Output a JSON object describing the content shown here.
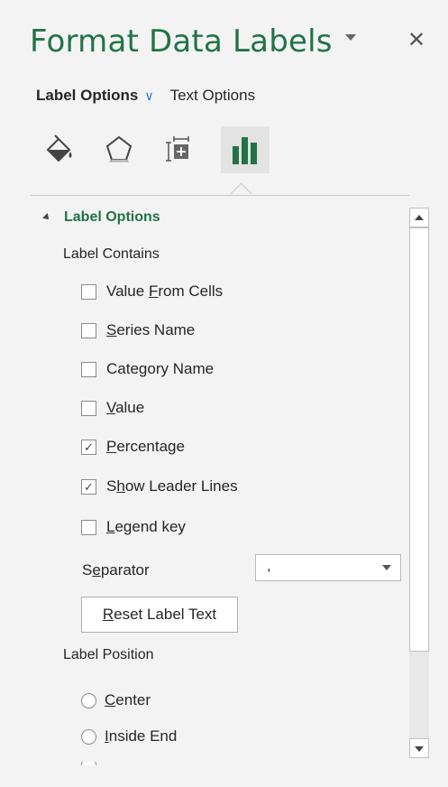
{
  "pane": {
    "title": "Format Data Labels",
    "close_glyph": "✕"
  },
  "tabs": {
    "label_options": "Label Options",
    "text_options": "Text Options",
    "chevron": "∨"
  },
  "icon_tabs": [
    {
      "icon": "fill-line-icon",
      "selected": false
    },
    {
      "icon": "effects-pentagon-icon",
      "selected": false
    },
    {
      "icon": "size-properties-icon",
      "selected": false
    },
    {
      "icon": "label-options-bar-chart-icon",
      "selected": true
    }
  ],
  "section": {
    "title": "Label Options",
    "label_contains": "Label Contains",
    "checkboxes": [
      {
        "label_pre": "Value ",
        "label_u": "F",
        "label_post": "rom Cells",
        "checked": false
      },
      {
        "label_pre": "",
        "label_u": "S",
        "label_post": "eries Name",
        "checked": false
      },
      {
        "label_pre": "Cate",
        "label_u": "g",
        "label_post": "ory Name",
        "checked": false
      },
      {
        "label_pre": "",
        "label_u": "V",
        "label_post": "alue",
        "checked": false
      },
      {
        "label_pre": "",
        "label_u": "P",
        "label_post": "ercentage",
        "checked": true
      },
      {
        "label_pre": "S",
        "label_u": "h",
        "label_post": "ow Leader Lines",
        "checked": true
      },
      {
        "label_pre": "",
        "label_u": "L",
        "label_post": "egend key",
        "checked": false
      }
    ],
    "separator": {
      "label_pre": "S",
      "label_u": "e",
      "label_post": "parator",
      "value": ","
    },
    "reset_button": {
      "label_u": "R",
      "label_post": "eset Label Text"
    },
    "label_position": "Label Position",
    "radios": [
      {
        "label_u": "C",
        "label_post": "enter",
        "selected": false
      },
      {
        "label_u": "I",
        "label_post": "nside End",
        "selected": false
      }
    ]
  },
  "colors": {
    "accent": "#217346",
    "pane_bg": "#f3f3f3",
    "chevron": "#2b7cd3"
  }
}
